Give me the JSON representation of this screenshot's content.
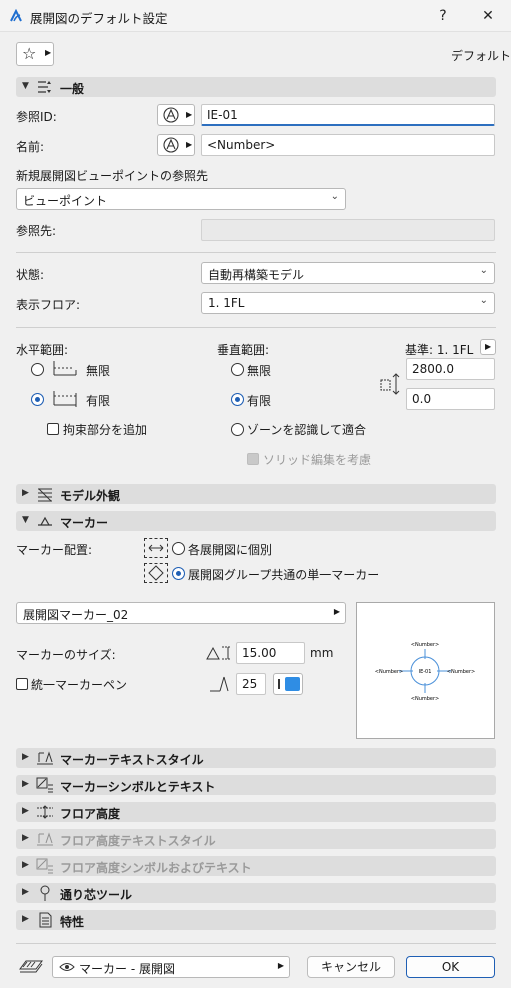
{
  "window": {
    "title": "展開図のデフォルト設定",
    "help": "?",
    "close": "✕"
  },
  "top": {
    "favorites_star": "☆",
    "default_label": "デフォルト"
  },
  "sections": {
    "general": "一般",
    "model_appearance": "モデル外観",
    "marker": "マーカー",
    "marker_text_style": "マーカーテキストスタイル",
    "marker_symbol_text": "マーカーシンボルとテキスト",
    "floor_height": "フロア高度",
    "floor_height_text_style": "フロア高度テキストスタイル",
    "floor_height_symbol_text": "フロア高度シンボルおよびテキスト",
    "grid_tool": "通り芯ツール",
    "properties": "特性"
  },
  "general": {
    "ref_id_label": "参照ID:",
    "ref_id_value": "IE-01",
    "name_label": "名前:",
    "name_value": "<Number>",
    "new_viewpoint_label": "新規展開図ビューポイントの参照先",
    "viewpoint_select": "ビューポイント",
    "ref_to_label": "参照先:",
    "status_label": "状態:",
    "status_value": "自動再構築モデル",
    "display_floor_label": "表示フロア:",
    "display_floor_value": "1. 1FL",
    "horizontal_label": "水平範囲:",
    "vertical_label": "垂直範囲:",
    "base_label": "基準: 1. 1FL",
    "h_infinite": "無限",
    "h_limited": "有限",
    "add_constraint": "拘束部分を追加",
    "v_infinite": "無限",
    "v_limited": "有限",
    "zone_fit": "ゾーンを認識して適合",
    "solid_edit": "ソリッド編集を考慮",
    "top_value": "2800.0",
    "bottom_value": "0.0"
  },
  "marker": {
    "placement_label": "マーカー配置:",
    "individual": "各展開図に個別",
    "group_single": "展開図グループ共通の単一マーカー",
    "marker_name": "展開図マーカー_02",
    "size_label": "マーカーのサイズ:",
    "size_value": "15.00",
    "size_unit": "mm",
    "uniform_pen": "統一マーカーペン",
    "pen_value": "25",
    "pen_color": "#2f8de4",
    "preview_center": "IE-01",
    "preview_top": "<Number>",
    "preview_left": "<Number>",
    "preview_right": "<Number>",
    "preview_bottom": "<Number>"
  },
  "footer": {
    "layer_value": "マーカー - 展開図",
    "cancel": "キャンセル",
    "ok": "OK"
  },
  "colors": {
    "accent": "#1f5fb4",
    "preview_circle": "#4a90d9"
  }
}
